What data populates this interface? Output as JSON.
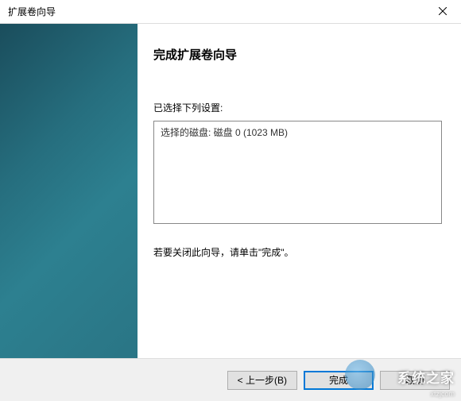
{
  "window": {
    "title": "扩展卷向导"
  },
  "content": {
    "heading": "完成扩展卷向导",
    "settings_label": "已选择下列设置:",
    "settings_text": "选择的磁盘: 磁盘 0 (1023 MB)",
    "hint": "若要关闭此向导，请单击\"完成\"。"
  },
  "buttons": {
    "back": "< 上一步(B)",
    "finish": "完成",
    "cancel": "取消"
  },
  "watermark": {
    "text": "系统之家",
    "url": "xtzjcom"
  }
}
